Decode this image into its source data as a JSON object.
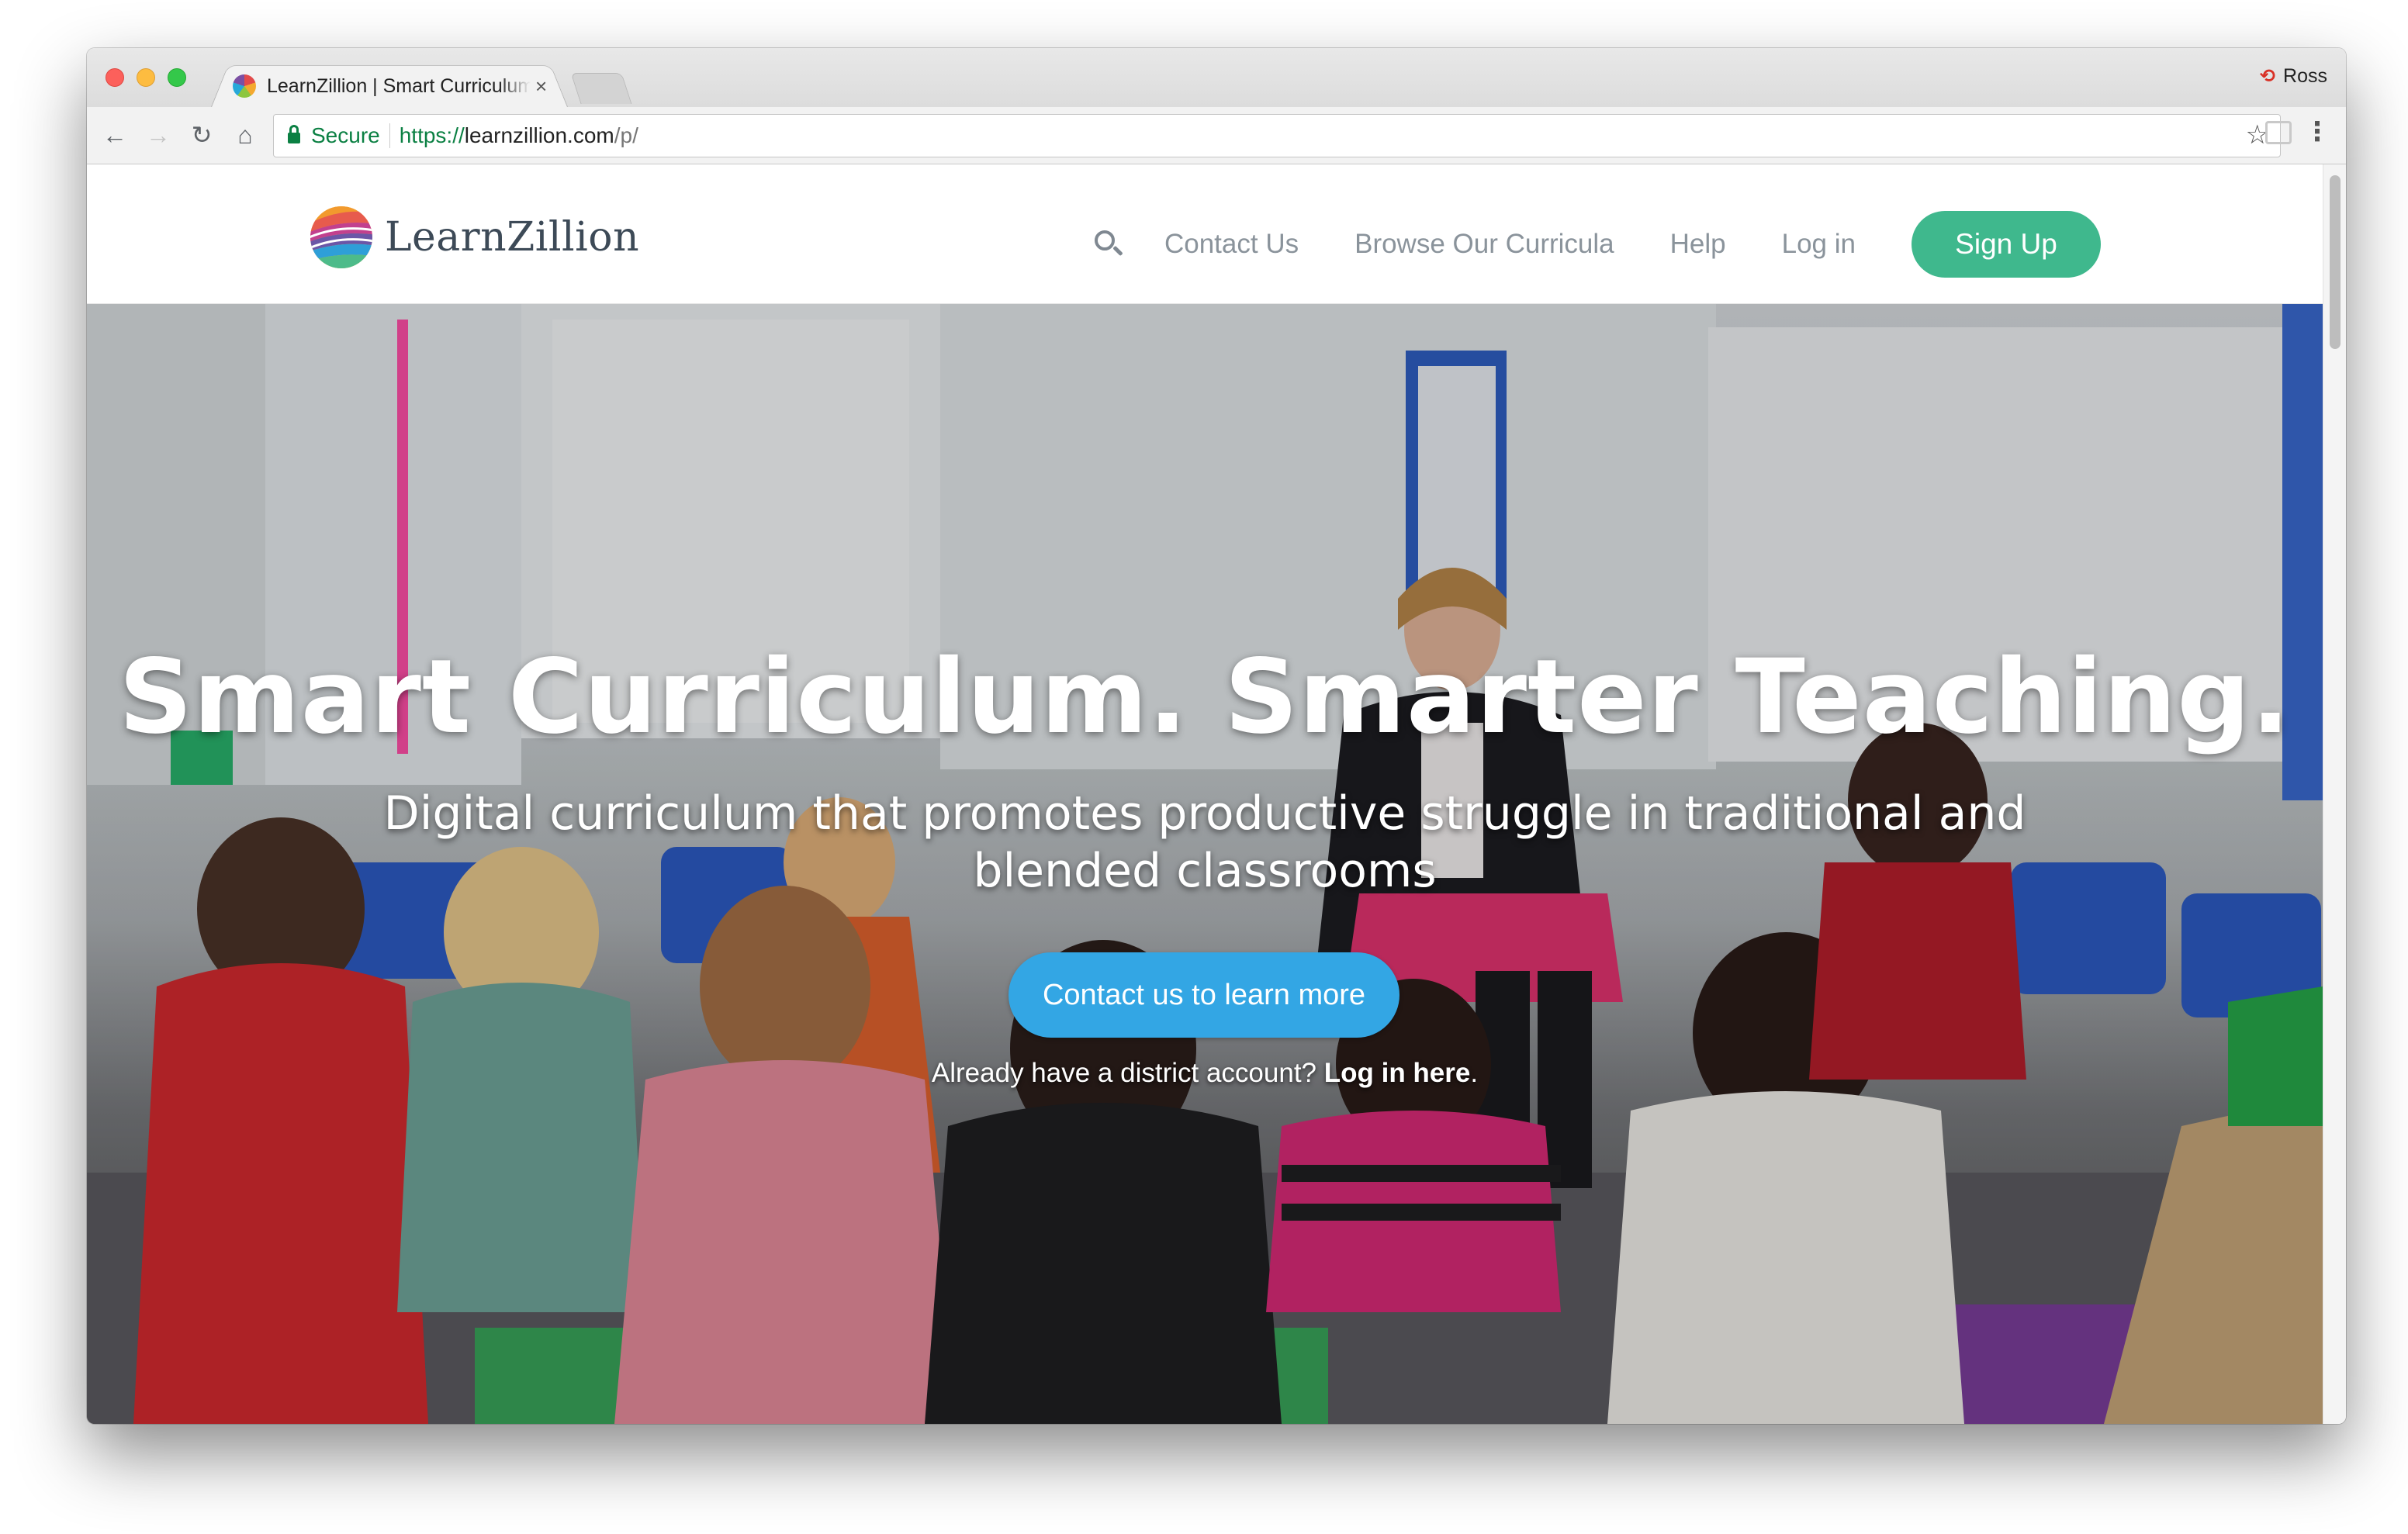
{
  "browser": {
    "tab_title": "LearnZillion | Smart Curriculum",
    "tab_close": "×",
    "profile_name": "Ross",
    "secure_label": "Secure",
    "url_scheme": "https://",
    "url_host": "learnzillion.com",
    "url_path": "/p/"
  },
  "site": {
    "logo_text": "LearnZillion",
    "nav": {
      "contact": "Contact Us",
      "browse": "Browse Our Curricula",
      "help": "Help",
      "login": "Log in",
      "signup": "Sign Up"
    },
    "colors": {
      "signup": "#3fb88d",
      "cta": "#33a6e4",
      "nav_text": "#8a939b"
    }
  },
  "hero": {
    "title": "Smart Curriculum. Smarter Teaching.",
    "subtitle": "Digital curriculum that promotes productive struggle in traditional and blended classrooms",
    "cta": "Contact us to learn more",
    "login_prefix": "Already have a district account? ",
    "login_link": "Log in here",
    "login_suffix": "."
  }
}
